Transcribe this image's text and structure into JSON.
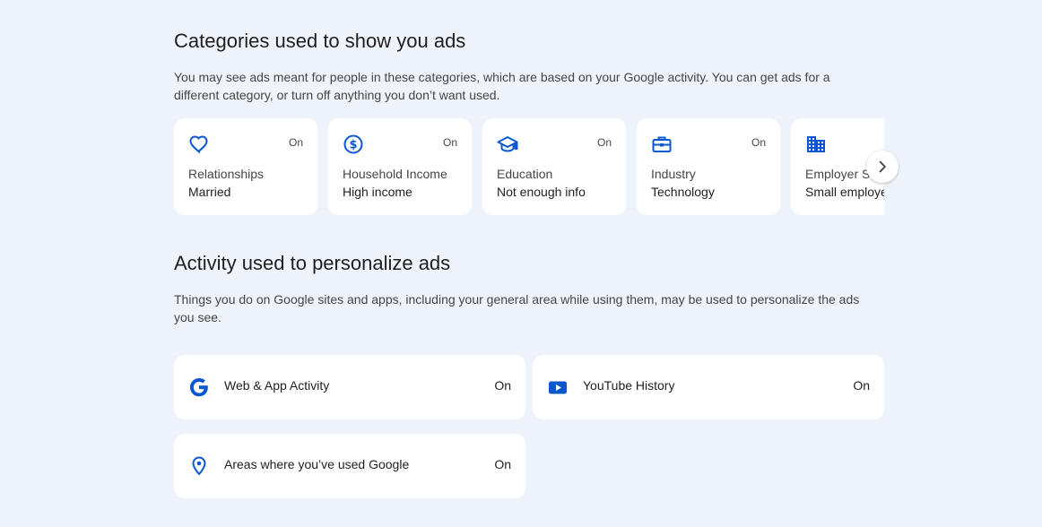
{
  "categories_section": {
    "title": "Categories used to show you ads",
    "description": "You may see ads meant for people in these categories, which are based on your Google activity. You can get ads for a different category, or turn off anything you don’t want used.",
    "cards": [
      {
        "icon": "heart-icon",
        "status": "On",
        "label": "Relationships",
        "value": "Married"
      },
      {
        "icon": "dollar-circle-icon",
        "status": "On",
        "label": "Household Income",
        "value": "High income"
      },
      {
        "icon": "graduation-cap-icon",
        "status": "On",
        "label": "Education",
        "value": "Not enough info"
      },
      {
        "icon": "briefcase-icon",
        "status": "On",
        "label": "Industry",
        "value": "Technology"
      },
      {
        "icon": "building-icon",
        "status": "On",
        "label": "Employer Size",
        "value": "Small employer"
      }
    ],
    "next_icon": "chevron-right-icon"
  },
  "activity_section": {
    "title": "Activity used to personalize ads",
    "description": "Things you do on Google sites and apps, including your general area while using them, may be used to personalize the ads you see.",
    "items": [
      {
        "icon": "google-g-icon",
        "label": "Web & App Activity",
        "status": "On"
      },
      {
        "icon": "youtube-icon",
        "label": "YouTube History",
        "status": "On"
      },
      {
        "icon": "location-pin-icon",
        "label": "Areas where you’ve used Google",
        "status": "On"
      }
    ]
  },
  "colors": {
    "background": "#eff3fb",
    "card": "#ffffff",
    "accent_blue": "#0b57d0"
  }
}
